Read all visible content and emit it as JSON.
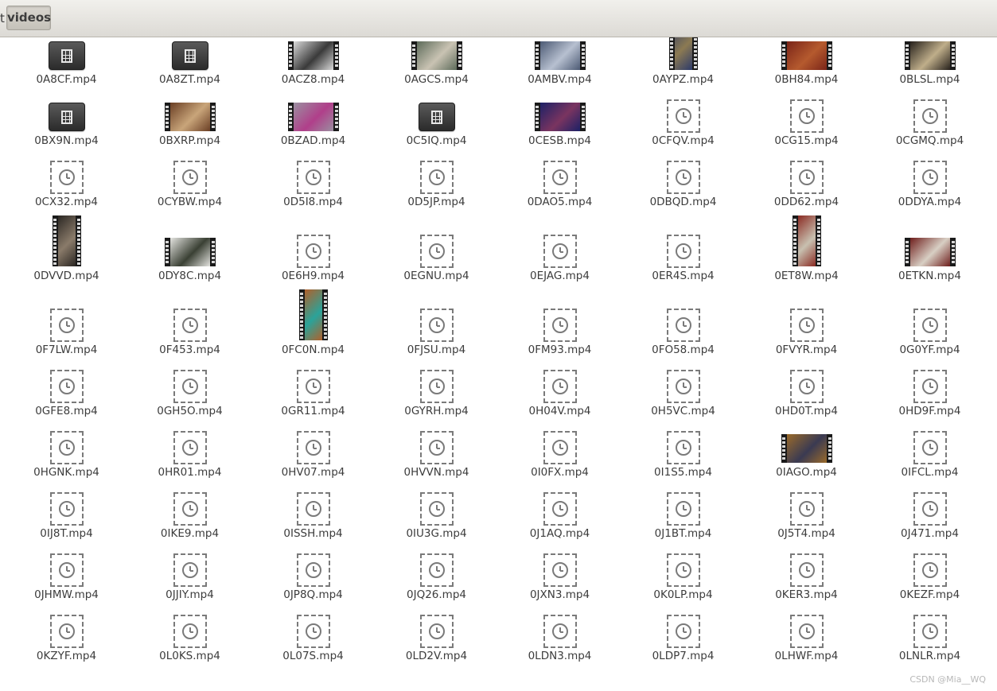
{
  "breadcrumb": {
    "previous_label": "t",
    "current_label": "videos"
  },
  "files": [
    {
      "name": "0A8CF.mp4",
      "thumb": "video-icon"
    },
    {
      "name": "0A8ZT.mp4",
      "thumb": "video-icon"
    },
    {
      "name": "0ACZ8.mp4",
      "thumb": "land",
      "c": [
        "#d9d9d9",
        "#3a3a3a"
      ]
    },
    {
      "name": "0AGCS.mp4",
      "thumb": "land",
      "c": [
        "#5d6b5a",
        "#c9c3b3"
      ]
    },
    {
      "name": "0AMBV.mp4",
      "thumb": "land",
      "c": [
        "#4c5a74",
        "#b7c0d0"
      ]
    },
    {
      "name": "0AYPZ.mp4",
      "thumb": "port",
      "c": [
        "#2c3a6a",
        "#8c7a52"
      ]
    },
    {
      "name": "0BH84.mp4",
      "thumb": "land",
      "c": [
        "#7a2418",
        "#b55a2e"
      ]
    },
    {
      "name": "0BLSL.mp4",
      "thumb": "land",
      "c": [
        "#27211c",
        "#bfae8a"
      ]
    },
    {
      "name": "0BX9N.mp4",
      "thumb": "video-icon"
    },
    {
      "name": "0BXRP.mp4",
      "thumb": "land",
      "c": [
        "#6a3e24",
        "#c9a57a"
      ]
    },
    {
      "name": "0BZAD.mp4",
      "thumb": "land",
      "c": [
        "#9a8fa0",
        "#b03f8a"
      ]
    },
    {
      "name": "0C5IQ.mp4",
      "thumb": "video-icon"
    },
    {
      "name": "0CESB.mp4",
      "thumb": "land",
      "c": [
        "#1c2166",
        "#7a3460"
      ]
    },
    {
      "name": "0CFQV.mp4",
      "thumb": "placeholder"
    },
    {
      "name": "0CG15.mp4",
      "thumb": "placeholder"
    },
    {
      "name": "0CGMQ.mp4",
      "thumb": "placeholder"
    },
    {
      "name": "0CX32.mp4",
      "thumb": "placeholder"
    },
    {
      "name": "0CYBW.mp4",
      "thumb": "placeholder"
    },
    {
      "name": "0D5I8.mp4",
      "thumb": "placeholder"
    },
    {
      "name": "0D5JP.mp4",
      "thumb": "placeholder"
    },
    {
      "name": "0DAO5.mp4",
      "thumb": "placeholder"
    },
    {
      "name": "0DBQD.mp4",
      "thumb": "placeholder"
    },
    {
      "name": "0DD62.mp4",
      "thumb": "placeholder"
    },
    {
      "name": "0DDYA.mp4",
      "thumb": "placeholder"
    },
    {
      "name": "0DVVD.mp4",
      "thumb": "port",
      "c": [
        "#2a2622",
        "#8a7b6a"
      ]
    },
    {
      "name": "0DY8C.mp4",
      "thumb": "land",
      "c": [
        "#e4e4e0",
        "#3a4034"
      ]
    },
    {
      "name": "0E6H9.mp4",
      "thumb": "placeholder"
    },
    {
      "name": "0EGNU.mp4",
      "thumb": "placeholder"
    },
    {
      "name": "0EJAG.mp4",
      "thumb": "placeholder"
    },
    {
      "name": "0ER4S.mp4",
      "thumb": "placeholder"
    },
    {
      "name": "0ET8W.mp4",
      "thumb": "port",
      "c": [
        "#8a2a22",
        "#c8c0b0"
      ]
    },
    {
      "name": "0ETKN.mp4",
      "thumb": "land",
      "c": [
        "#6e1e1c",
        "#d8cfc4"
      ]
    },
    {
      "name": "0F7LW.mp4",
      "thumb": "placeholder"
    },
    {
      "name": "0F453.mp4",
      "thumb": "placeholder"
    },
    {
      "name": "0FC0N.mp4",
      "thumb": "port",
      "c": [
        "#b2602a",
        "#2aa39a"
      ]
    },
    {
      "name": "0FJSU.mp4",
      "thumb": "placeholder"
    },
    {
      "name": "0FM93.mp4",
      "thumb": "placeholder"
    },
    {
      "name": "0FO58.mp4",
      "thumb": "placeholder"
    },
    {
      "name": "0FVYR.mp4",
      "thumb": "placeholder"
    },
    {
      "name": "0G0YF.mp4",
      "thumb": "placeholder"
    },
    {
      "name": "0GFE8.mp4",
      "thumb": "placeholder"
    },
    {
      "name": "0GH5O.mp4",
      "thumb": "placeholder"
    },
    {
      "name": "0GR11.mp4",
      "thumb": "placeholder"
    },
    {
      "name": "0GYRH.mp4",
      "thumb": "placeholder"
    },
    {
      "name": "0H04V.mp4",
      "thumb": "placeholder"
    },
    {
      "name": "0H5VC.mp4",
      "thumb": "placeholder"
    },
    {
      "name": "0HD0T.mp4",
      "thumb": "placeholder"
    },
    {
      "name": "0HD9F.mp4",
      "thumb": "placeholder"
    },
    {
      "name": "0HGNK.mp4",
      "thumb": "placeholder"
    },
    {
      "name": "0HR01.mp4",
      "thumb": "placeholder"
    },
    {
      "name": "0HV07.mp4",
      "thumb": "placeholder"
    },
    {
      "name": "0HVVN.mp4",
      "thumb": "placeholder"
    },
    {
      "name": "0I0FX.mp4",
      "thumb": "placeholder"
    },
    {
      "name": "0I1S5.mp4",
      "thumb": "placeholder"
    },
    {
      "name": "0IAGO.mp4",
      "thumb": "land",
      "c": [
        "#9a6a2a",
        "#3a3a52"
      ]
    },
    {
      "name": "0IFCL.mp4",
      "thumb": "placeholder"
    },
    {
      "name": "0IJ8T.mp4",
      "thumb": "placeholder"
    },
    {
      "name": "0IKE9.mp4",
      "thumb": "placeholder"
    },
    {
      "name": "0ISSH.mp4",
      "thumb": "placeholder"
    },
    {
      "name": "0IU3G.mp4",
      "thumb": "placeholder"
    },
    {
      "name": "0J1AQ.mp4",
      "thumb": "placeholder"
    },
    {
      "name": "0J1BT.mp4",
      "thumb": "placeholder"
    },
    {
      "name": "0J5T4.mp4",
      "thumb": "placeholder"
    },
    {
      "name": "0J471.mp4",
      "thumb": "placeholder"
    },
    {
      "name": "0JHMW.mp4",
      "thumb": "placeholder"
    },
    {
      "name": "0JJIY.mp4",
      "thumb": "placeholder"
    },
    {
      "name": "0JP8Q.mp4",
      "thumb": "placeholder"
    },
    {
      "name": "0JQ26.mp4",
      "thumb": "placeholder"
    },
    {
      "name": "0JXN3.mp4",
      "thumb": "placeholder"
    },
    {
      "name": "0K0LP.mp4",
      "thumb": "placeholder"
    },
    {
      "name": "0KER3.mp4",
      "thumb": "placeholder"
    },
    {
      "name": "0KEZF.mp4",
      "thumb": "placeholder"
    },
    {
      "name": "0KZYF.mp4",
      "thumb": "placeholder"
    },
    {
      "name": "0L0KS.mp4",
      "thumb": "placeholder"
    },
    {
      "name": "0L07S.mp4",
      "thumb": "placeholder"
    },
    {
      "name": "0LD2V.mp4",
      "thumb": "placeholder"
    },
    {
      "name": "0LDN3.mp4",
      "thumb": "placeholder"
    },
    {
      "name": "0LDP7.mp4",
      "thumb": "placeholder"
    },
    {
      "name": "0LHWF.mp4",
      "thumb": "placeholder"
    },
    {
      "name": "0LNLR.mp4",
      "thumb": "placeholder"
    }
  ],
  "watermark": "CSDN @Mia__WQ",
  "colors": {
    "text": "#3c3c3c",
    "placeholder_stroke": "#7a7a7a",
    "toolbar_top": "#f1f0ec",
    "toolbar_bottom": "#dcdad5"
  }
}
